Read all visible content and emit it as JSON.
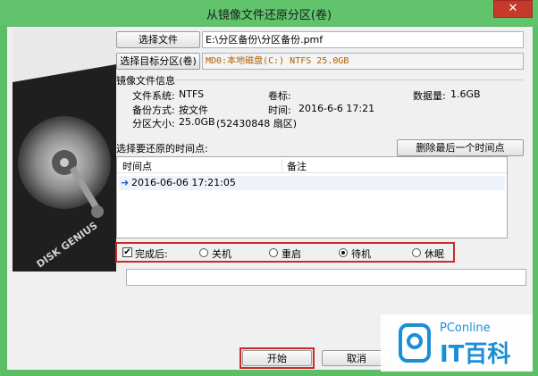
{
  "window": {
    "title": "从镜像文件还原分区(卷)",
    "close_glyph": "✕"
  },
  "art": {
    "brand": "DISK GENIUS"
  },
  "file": {
    "select_button": "选择文件",
    "path": "E:\\分区备份\\分区备份.pmf"
  },
  "target": {
    "select_button": "选择目标分区(卷)",
    "value": "MD0:本地磁盘(C:) NTFS 25.0GB"
  },
  "image_info": {
    "heading": "镜像文件信息",
    "fs_label": "文件系统:",
    "fs_value": "NTFS",
    "volume_label": "卷标:",
    "volume_value": "",
    "data_label": "数据量:",
    "data_value": "1.6GB",
    "method_label": "备份方式:",
    "method_value": "按文件",
    "time_label": "时间:",
    "time_value": "2016-6-6 17:21",
    "size_label": "分区大小:",
    "size_value": "25.0GB",
    "sectors": "(52430848 扇区)"
  },
  "restore_points": {
    "label": "选择要还原的时间点:",
    "delete_button": "删除最后一个时间点",
    "columns": [
      "时间点",
      "备注"
    ],
    "rows": [
      {
        "time": "2016-06-06 17:21:05",
        "note": ""
      }
    ]
  },
  "after": {
    "checkbox_label": "完成后:",
    "checked": true,
    "options": [
      "关机",
      "重启",
      "待机",
      "休眠"
    ],
    "selected": "待机"
  },
  "progress_text": "",
  "actions": {
    "start": "开始",
    "cancel": "取消"
  },
  "watermark": {
    "brand": "PConline",
    "text": "IT百科"
  },
  "colors": {
    "titlebar": "#61c46d",
    "close": "#c7392b",
    "highlight": "#cc2a2a",
    "brand_blue": "#1a8fd8"
  }
}
